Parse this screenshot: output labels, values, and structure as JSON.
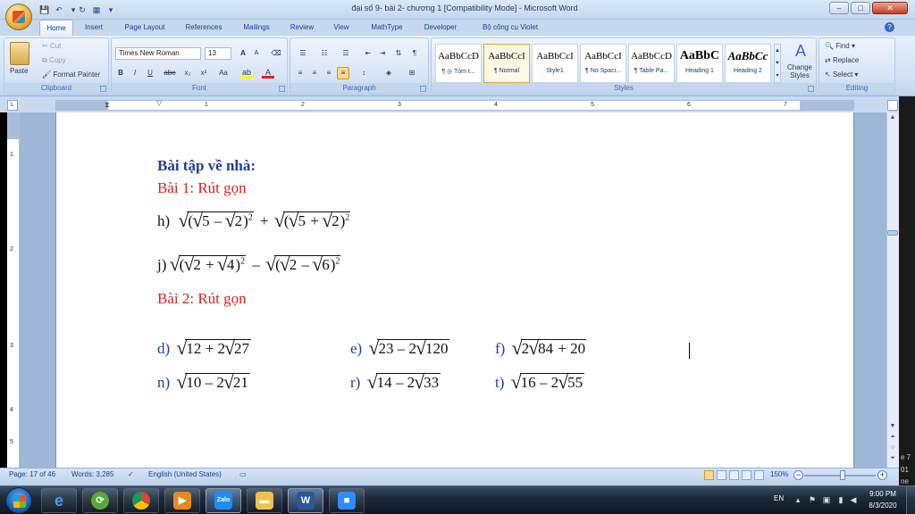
{
  "window": {
    "title": "đại số 9- bài 2- chương 1 [Compatibility Mode] - Microsoft Word",
    "minimize": "–",
    "maximize": "□",
    "close": "✕"
  },
  "tabs": [
    "Home",
    "Insert",
    "Page Layout",
    "References",
    "Mailings",
    "Review",
    "View",
    "MathType",
    "Developer",
    "Bộ công cụ Violet"
  ],
  "ribbon": {
    "clipboard": {
      "paste": "Paste",
      "cut": "Cut",
      "copy": "Copy",
      "format_painter": "Format Painter",
      "label": "Clipboard"
    },
    "font": {
      "name": "Times New Roman",
      "size": "13",
      "label": "Font",
      "bold": "B",
      "italic": "I",
      "underline": "U",
      "strike": "abe",
      "subscript": "x₂",
      "superscript": "x²",
      "change_case": "Aa",
      "grow": "A",
      "shrink": "A"
    },
    "paragraph": {
      "label": "Paragraph",
      "pilcrow": "¶"
    },
    "styles": {
      "label": "Styles",
      "items": [
        {
          "sample": "AaBbCcD",
          "name": "¶ ◎ Tóm t..."
        },
        {
          "sample": "AaBbCcI",
          "name": "¶ Normal"
        },
        {
          "sample": "AaBbCcI",
          "name": "Style1"
        },
        {
          "sample": "AaBbCcI",
          "name": "¶ No Spaci..."
        },
        {
          "sample": "AaBbCcD",
          "name": "¶ Table Pa..."
        },
        {
          "sample": "AaBbC",
          "name": "Heading 1"
        },
        {
          "sample": "AaBbCc",
          "name": "Heading 2"
        }
      ],
      "change_styles": "Change Styles"
    },
    "editing": {
      "label": "Editing",
      "find": "Find",
      "replace": "Replace",
      "select": "Select"
    }
  },
  "ruler": {
    "numbers": [
      "1",
      "2",
      "3",
      "4",
      "5",
      "6",
      "7"
    ]
  },
  "vruler": {
    "numbers": [
      "1",
      "2",
      "3",
      "4",
      "5"
    ]
  },
  "document": {
    "heading": "Bài tập về nhà:",
    "bai1": "Bài 1: Rút gọn",
    "bai2": "Bài 2: Rút gọn",
    "h_label": "h)",
    "j_label": "j)",
    "items": [
      {
        "label": "d)",
        "a": "12",
        "coef": "2",
        "b": "27"
      },
      {
        "label": "e)",
        "a": "23",
        "coef": "2",
        "b": "120"
      },
      {
        "label": "f)",
        "prefix": "2",
        "a": "84",
        "b": "20"
      },
      {
        "label": "n)",
        "a": "10",
        "coef": "2",
        "b": "21"
      },
      {
        "label": "r)",
        "a": "14",
        "coef": "2",
        "b": "33"
      },
      {
        "label": "t)",
        "a": "16",
        "coef": "2",
        "b": "55"
      }
    ]
  },
  "status": {
    "page": "Page: 17 of 46",
    "words": "Words: 3,285",
    "language": "English (United States)",
    "zoom": "150%"
  },
  "taskbar": {
    "apps": [
      "ie-icon",
      "app-icon",
      "chrome-icon",
      "media-icon",
      "zalo-icon",
      "explorer-icon",
      "word-icon",
      "zoom-icon"
    ],
    "lang": "EN",
    "time": "9:00 PM",
    "date": "8/3/2020",
    "sliver": [
      "e 7",
      "01",
      "ne"
    ]
  },
  "colors": {
    "accent": "#1f3f9e",
    "red": "#d52222",
    "ribbon": "#d2e1f4"
  }
}
